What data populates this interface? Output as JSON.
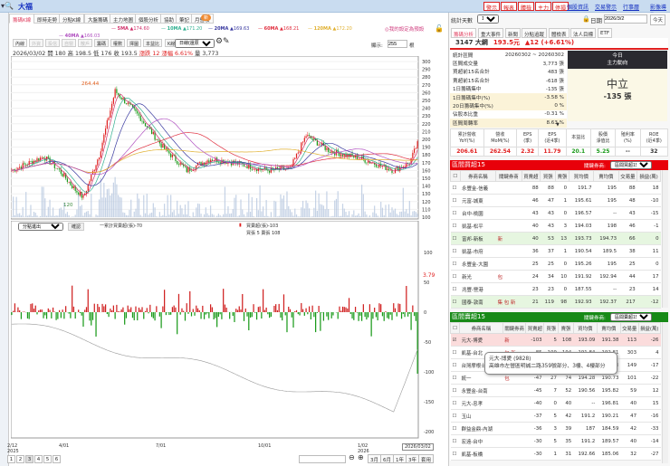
{
  "header": {
    "title": "大福",
    "action_buttons": [
      "警示",
      "報表",
      "體檢",
      "主力",
      "停損"
    ],
    "links": [
      "個股資訊",
      "交易警示",
      "行事曆",
      "影像導覽"
    ]
  },
  "tabs": [
    "籌碼K線",
    "即時走勢",
    "分點K線",
    "大盤籌碼",
    "主力地圖",
    "個股分析",
    "協助",
    "筆記",
    "月營收"
  ],
  "tab_badge": "新",
  "ma_legend": [
    {
      "label": "5MA",
      "value": "174.60",
      "color": "#d0306a"
    },
    {
      "label": "10MA",
      "value": "171.20",
      "color": "#30b090"
    },
    {
      "label": "20MA",
      "value": "169.63",
      "color": "#3a3aa0"
    },
    {
      "label": "60MA",
      "value": "168.21",
      "color": "#e03040"
    },
    {
      "label": "120MA",
      "value": "172.20",
      "color": "#e0b030"
    },
    {
      "label": "40MA",
      "value": "166.03",
      "color": "#b050c0"
    }
  ],
  "hint_link": "◎我的設定為預設",
  "chart_toolbar": {
    "buttons": [
      "內線",
      "外資",
      "投信",
      "自營",
      "散戶",
      "籌碼",
      "權數",
      "擇圖",
      "本益比",
      "K線圖",
      "分價圖"
    ],
    "select": "日線(還原)",
    "zoom_label": "顯示:",
    "zoom_value": "255",
    "zoom_unit": "根"
  },
  "ohlc": {
    "date": "2026/03/02",
    "open_label": "開",
    "open": "180",
    "high_label": "高",
    "high": "198.5",
    "low_label": "低",
    "low": "176",
    "close_label": "收",
    "close": "193.5",
    "chg_label": "漲跌",
    "chg": "12",
    "pct_label": "漲幅",
    "pct": "6.61%",
    "vol_label": "量",
    "vol": "3,773"
  },
  "price_chart": {
    "peak_label": "264.44",
    "trough_label": "120",
    "y_ticks": [
      "300",
      "290",
      "280",
      "270",
      "260",
      "250",
      "240",
      "230",
      "220",
      "210",
      "200",
      "190",
      "180",
      "170",
      "160",
      "150",
      "140",
      "130",
      "120",
      "110",
      "100"
    ]
  },
  "lower_chart": {
    "select": "分點進出",
    "btn": "確認",
    "legend1": "一累計買賣超(張)-70",
    "legend2": "買賣超(張)-103",
    "legend3": "買張 5 賣張 108",
    "current": "3.79",
    "y_ticks": [
      "100",
      "50",
      "0",
      "-50",
      "-100",
      "-150",
      "-200"
    ]
  },
  "x_axis": {
    "labels": [
      "2/12\n2025",
      "4/01",
      "7/01",
      "10/01",
      "1/02\n2026"
    ],
    "current": "2026/03/02"
  },
  "pager": {
    "pages": [
      "1",
      "2",
      "3",
      "4",
      "5",
      "6"
    ],
    "ranges": [
      "3月",
      "6月",
      "1年",
      "3年"
    ],
    "apply": "套用"
  },
  "right": {
    "days_label": "統計天數",
    "days": "1",
    "date_label": "日期",
    "date": "2026/3/2",
    "today_btn": "今天",
    "tabs": [
      "籌碼分析",
      "重大事件",
      "新聞",
      "分點追蹤",
      "體檢表",
      "法人目標",
      "ETF"
    ],
    "stock": {
      "code_name": "3147 大綱",
      "price": "193.5元",
      "change": "▲12 (+6.61%)"
    },
    "summary": [
      [
        "統計區間",
        "20260302 ~ 20260302"
      ],
      [
        "區間成交量",
        "3,773 張"
      ],
      [
        "買超前15名合計",
        "483 張"
      ],
      [
        "賣超前15名合計",
        "-618 張"
      ],
      [
        "1日籌碼集中",
        "-135 張"
      ],
      [
        "1日籌碼集中(%)",
        "-3.58 %"
      ],
      [
        "20日籌碼集中(%)",
        "0 %"
      ],
      [
        "佔股本比重",
        "-0.31 %"
      ],
      [
        "區間周轉率",
        "8.63 %"
      ]
    ],
    "today": {
      "label": "今日",
      "sub": "主力動向",
      "state": "中立",
      "value": "-135 張"
    },
    "fund_headers": [
      "累計營收\nYoY(%)",
      "營收\nMoM(%)",
      "EPS\n(季)",
      "EPS\n(近4季)",
      "本益比",
      "股價\n淨值比",
      "殖利率\n(%)",
      "ROE\n(近4季)"
    ],
    "fund_values": [
      "206.61",
      "262.54",
      "2.32",
      "11.79",
      "20.1",
      "5.25",
      "--",
      "32"
    ],
    "buy_title": "區間買超15",
    "sell_title": "區間賣超15",
    "kw_label": "關鍵券商:",
    "buy_select": "區間買超15",
    "sell_select": "區間賣超15",
    "cols": [
      "券商名稱",
      "關鍵券商",
      "買賣超",
      "買張",
      "賣張",
      "買均價",
      "賣均價",
      "交易量",
      "損益(萬)"
    ],
    "buy_rows": [
      [
        "永豐金-信義",
        "",
        "88",
        "88",
        "0",
        "191.7",
        "195",
        "88",
        "18"
      ],
      [
        "元富-城東",
        "",
        "46",
        "47",
        "1",
        "195.61",
        "195",
        "48",
        "-10"
      ],
      [
        "台中-桃園",
        "",
        "43",
        "43",
        "0",
        "196.57",
        "--",
        "43",
        "-15"
      ],
      [
        "凱基-松平",
        "",
        "40",
        "43",
        "3",
        "194.03",
        "198",
        "46",
        "-1"
      ],
      [
        "富邦-新板",
        "新",
        "40",
        "53",
        "13",
        "193.73",
        "194.73",
        "66",
        "0"
      ],
      [
        "凱基-市府",
        "",
        "36",
        "37",
        "1",
        "190.54",
        "189.5",
        "38",
        "11"
      ],
      [
        "永豐金-大園",
        "",
        "25",
        "25",
        "0",
        "195.26",
        "195",
        "25",
        "0"
      ],
      [
        "新光",
        "包",
        "24",
        "34",
        "10",
        "191.92",
        "192.94",
        "44",
        "17"
      ],
      [
        "兆豐-營港",
        "",
        "23",
        "23",
        "0",
        "187.55",
        "--",
        "23",
        "14"
      ],
      [
        "國泰-敦南",
        "集 包 新",
        "21",
        "119",
        "98",
        "192.93",
        "192.37",
        "217",
        "-12"
      ]
    ],
    "sell_rows": [
      [
        "元大-博愛",
        "新",
        "-103",
        "5",
        "108",
        "193.09",
        "191.38",
        "113",
        "-26"
      ],
      [
        "凱基-台北",
        "包 新",
        "-85",
        "109",
        "194",
        "191.84",
        "192.81",
        "303",
        "4"
      ],
      [
        "台灣摩根士丹利",
        "",
        "-63",
        "43",
        "106",
        "193.64",
        "191.63",
        "149",
        "-17"
      ],
      [
        "統一",
        "包",
        "-47",
        "27",
        "74",
        "194.28",
        "190.73",
        "101",
        "-22"
      ],
      [
        "永豐金-台南",
        "",
        "-45",
        "7",
        "52",
        "190.56",
        "195.82",
        "59",
        "12"
      ],
      [
        "元大-忠孝",
        "",
        "-40",
        "0",
        "40",
        "--",
        "196.81",
        "40",
        "15"
      ],
      [
        "玉山",
        "",
        "-37",
        "5",
        "42",
        "191.2",
        "190.21",
        "47",
        "-16"
      ],
      [
        "群益金鼎-內湖",
        "",
        "-36",
        "3",
        "39",
        "187",
        "184.59",
        "42",
        "-33"
      ],
      [
        "宏遠-台中",
        "",
        "-30",
        "5",
        "35",
        "191.2",
        "189.57",
        "40",
        "-14"
      ],
      [
        "凱基-板橋",
        "",
        "-30",
        "1",
        "31",
        "192.66",
        "185.06",
        "32",
        "-27"
      ]
    ],
    "tooltip": {
      "title": "元大-博愛 (9828)",
      "addr": "高雄市左營區明誠二路359號部分、3樓、4樓部分"
    }
  },
  "colors": {
    "up": "#e02020",
    "down": "#1a9a1a",
    "buy_header": "#e8000a",
    "sell_header": "#178a17"
  }
}
